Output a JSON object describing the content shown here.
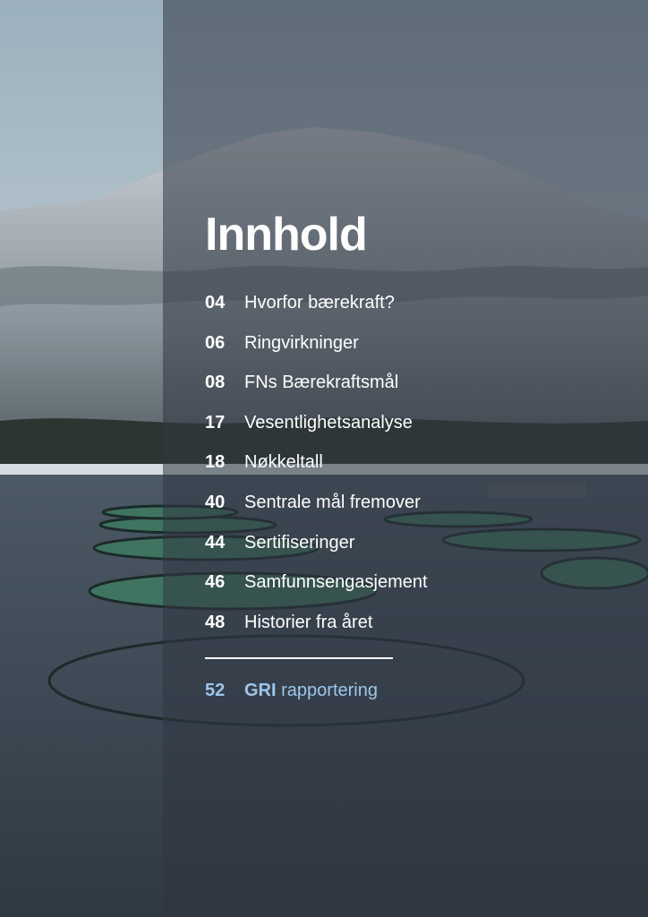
{
  "page": {
    "title": "Innhold"
  },
  "toc": {
    "items": [
      {
        "number": "04",
        "label": "Hvorfor bærekraft?"
      },
      {
        "number": "06",
        "label": "Ringvirkninger"
      },
      {
        "number": "08",
        "label": "FNs Bærekraftsmål"
      },
      {
        "number": "17",
        "label": "Vesentlighetsanalyse"
      },
      {
        "number": "18",
        "label": "Nøkkeltall"
      },
      {
        "number": "40",
        "label": "Sentrale mål fremover"
      },
      {
        "number": "44",
        "label": "Sertifiseringer"
      },
      {
        "number": "46",
        "label": "Samfunnsengasjement"
      },
      {
        "number": "48",
        "label": "Historier fra året"
      }
    ],
    "gri": {
      "number": "52",
      "label_strong": "GRI",
      "label_rest": "rapportering"
    }
  },
  "colors": {
    "text": "#ffffff",
    "accent": "#9ec6ea",
    "overlay": "#303642"
  }
}
